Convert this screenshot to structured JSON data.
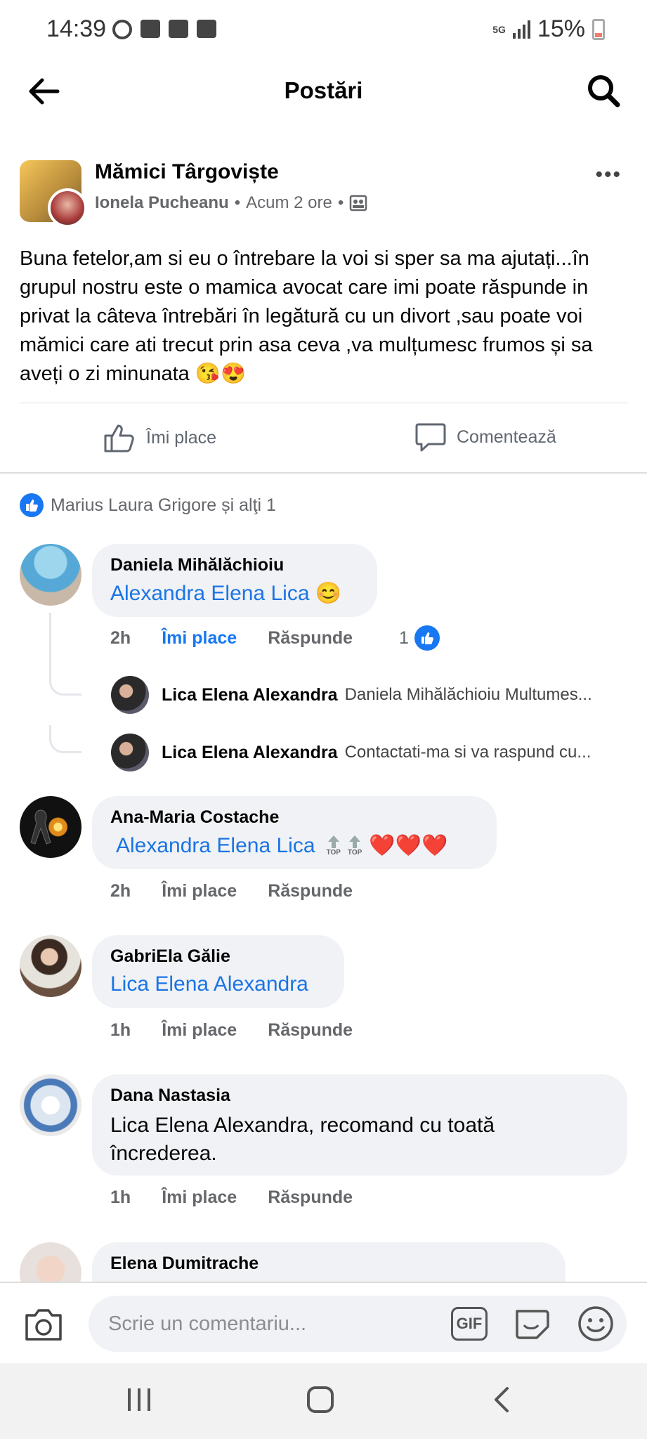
{
  "status_bar": {
    "time": "14:39",
    "network": "5G",
    "battery": "15%"
  },
  "header": {
    "title": "Postări"
  },
  "post": {
    "group_name": "Mămici Târgoviște",
    "author": "Ionela Pucheanu",
    "time": "Acum 2 ore",
    "separator": "•",
    "text": "Buna fetelor,am si eu o întrebare la voi si sper sa ma ajutați...în grupul nostru este o mamica avocat care imi poate răspunde in privat la câteva întrebări în legătură cu un divort ,sau poate voi mămici care ati trecut prin asa ceva ,va mulțumesc frumos și sa aveți o zi minunata 😘😍",
    "like_label": "Îmi place",
    "comment_label": "Comentează",
    "likes_text": "Marius Laura Grigore și alţi 1"
  },
  "comments": [
    {
      "name": "Daniela Mihălăchioiu",
      "text": "Alexandra Elena Lica 😊",
      "time": "2h",
      "like": "Îmi place",
      "reply": "Răspunde",
      "like_count": "1",
      "replies": [
        {
          "name": "Lica Elena Alexandra",
          "text": "Daniela Mihălăchioiu Multumes..."
        },
        {
          "name": "Lica Elena Alexandra",
          "text": "Contactati-ma si va raspund cu..."
        }
      ]
    },
    {
      "name": "Ana-Maria Costache",
      "text": "Alexandra Elena Lica",
      "badges": [
        "TOP",
        "TOP"
      ],
      "emoji": "❤️❤️❤️",
      "time": "2h",
      "like": "Îmi place",
      "reply": "Răspunde"
    },
    {
      "name": "GabriEla Gălie",
      "text": "Lica Elena Alexandra",
      "time": "1h",
      "like": "Îmi place",
      "reply": "Răspunde"
    },
    {
      "name": "Dana Nastasia",
      "text": "Lica Elena Alexandra, recomand cu toată încrederea.",
      "time": "1h",
      "like": "Îmi place",
      "reply": "Răspunde"
    },
    {
      "name": "Elena Dumitrache"
    }
  ],
  "composer": {
    "placeholder": "Scrie un comentariu...",
    "gif_label": "GIF"
  },
  "icons": {
    "back": "arrow-left-icon",
    "search": "search-icon",
    "more": "more-options-icon",
    "like": "thumbs-up-icon",
    "comment": "comment-icon",
    "camera": "camera-icon",
    "sticker": "sticker-icon",
    "emoji": "emoji-icon"
  },
  "colors": {
    "accent": "#1877f2",
    "mention": "#1b74e4",
    "bubble": "#f0f2f5"
  }
}
